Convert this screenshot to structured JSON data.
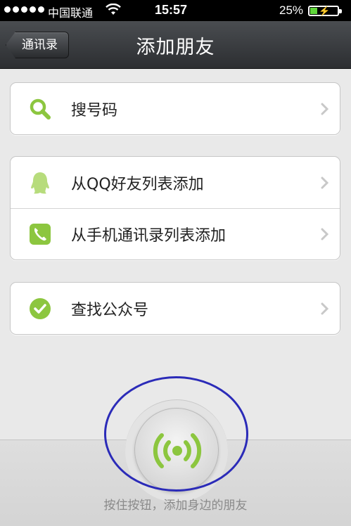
{
  "status": {
    "carrier": "中国联通",
    "time": "15:57",
    "battery": "25%",
    "battery_level": 0.25
  },
  "nav": {
    "back_label": "通讯录",
    "title": "添加朋友"
  },
  "items": {
    "search": {
      "label": "搜号码",
      "icon": "search-icon"
    },
    "qq": {
      "label": "从QQ好友列表添加",
      "icon": "qq-penguin-icon"
    },
    "contacts": {
      "label": "从手机通讯录列表添加",
      "icon": "phone-icon"
    },
    "official": {
      "label": "查找公众号",
      "icon": "check-circle-icon"
    }
  },
  "radar": {
    "hint": "按住按钮，添加身边的朋友",
    "icon": "radar-signal-icon"
  },
  "colors": {
    "accent_green": "#8cc63f",
    "annotation_blue": "#2b2bb8"
  }
}
